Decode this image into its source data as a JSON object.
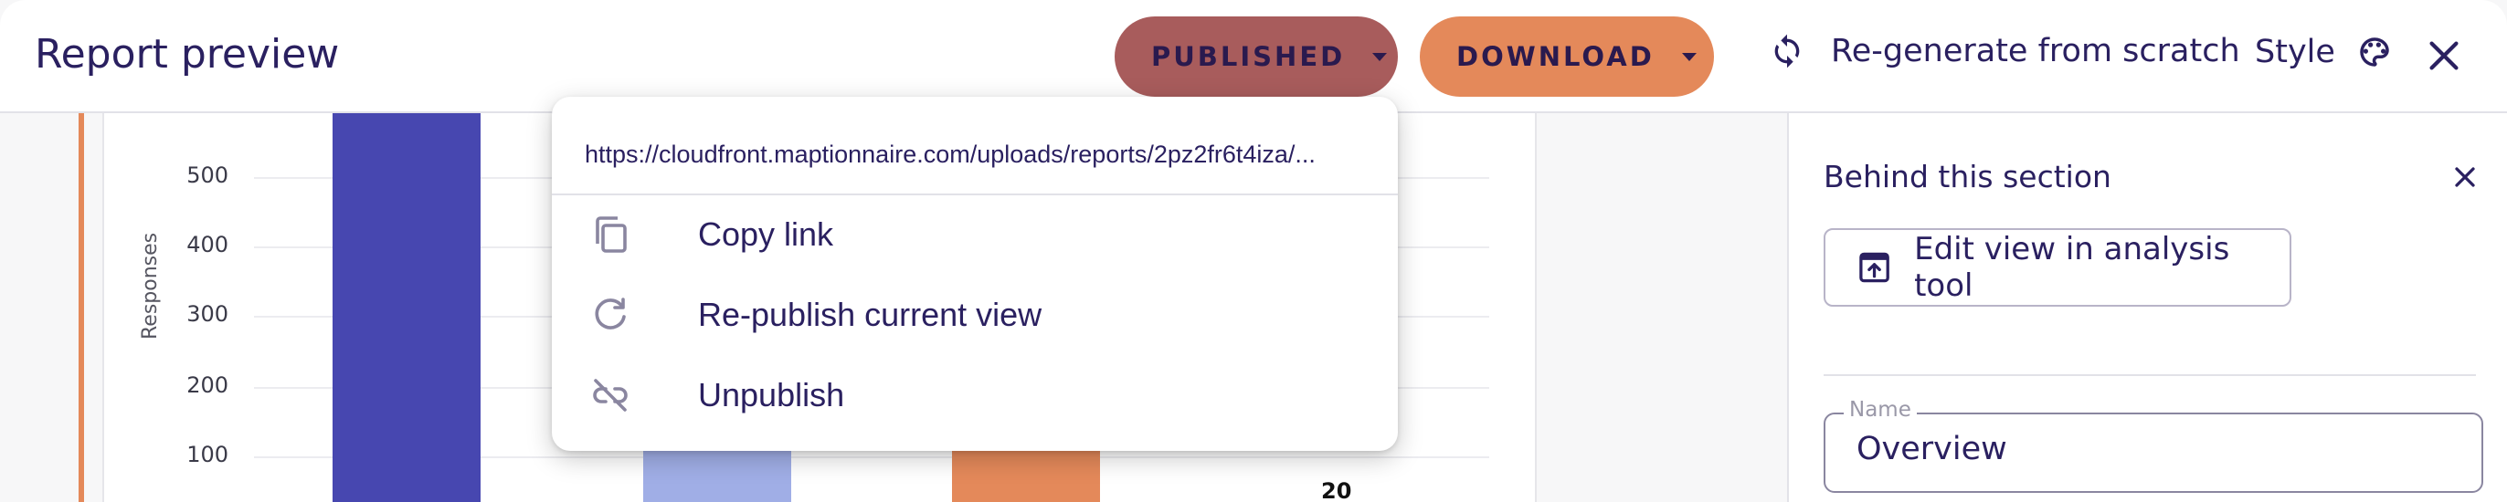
{
  "header": {
    "title": "Report preview",
    "published_label": "PUBLISHED",
    "download_label": "DOWNLOAD",
    "regenerate_label": "Re-generate from scratch",
    "style_label": "Style"
  },
  "menu": {
    "url": "https://cloudfront.maptionnaire.com/uploads/reports/2pz2fr6t4iza/...",
    "items": [
      {
        "label": "Copy link",
        "icon": "copy-icon"
      },
      {
        "label": "Re-publish current view",
        "icon": "refresh-icon"
      },
      {
        "label": "Unpublish",
        "icon": "link-off-icon"
      }
    ]
  },
  "chart_data": {
    "type": "bar",
    "ylabel": "Responses",
    "yticks": [
      "500",
      "400",
      "300",
      "200",
      "100"
    ],
    "visible_value_labels": [
      "20"
    ],
    "colors": [
      "#4747b0",
      "#a0aee6",
      "#e4895a"
    ]
  },
  "side_panel": {
    "title": "Behind this section",
    "edit_button_label": "Edit view in analysis tool",
    "name_field_label": "Name",
    "name_field_value": "Overview"
  }
}
